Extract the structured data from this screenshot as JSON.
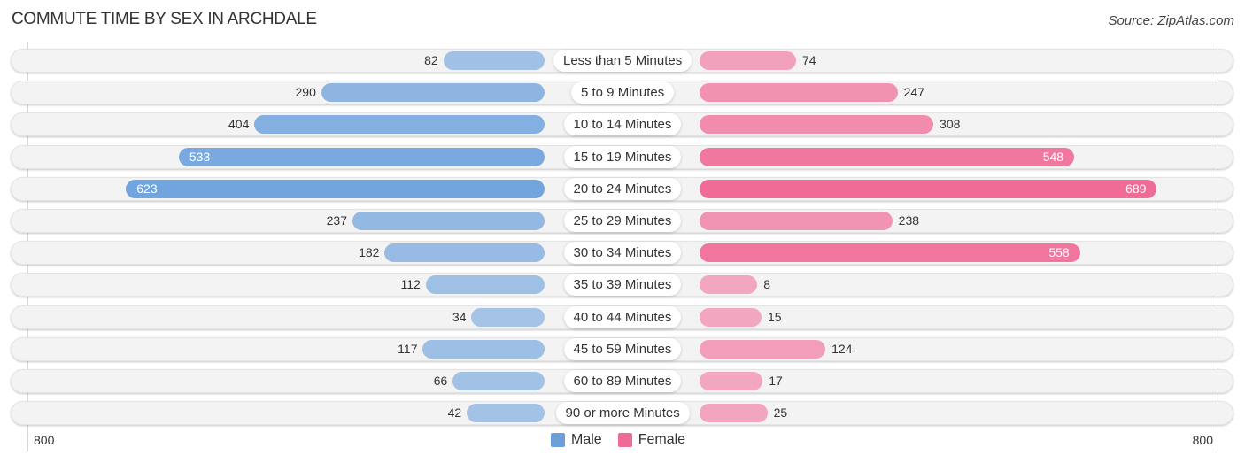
{
  "chart_data": {
    "type": "bar",
    "orientation": "horizontal-diverging",
    "title": "COMMUTE TIME BY SEX IN ARCHDALE",
    "source": "Source: ZipAtlas.com",
    "categories": [
      "Less than 5 Minutes",
      "5 to 9 Minutes",
      "10 to 14 Minutes",
      "15 to 19 Minutes",
      "20 to 24 Minutes",
      "25 to 29 Minutes",
      "30 to 34 Minutes",
      "35 to 39 Minutes",
      "40 to 44 Minutes",
      "45 to 59 Minutes",
      "60 to 89 Minutes",
      "90 or more Minutes"
    ],
    "series": [
      {
        "name": "Male",
        "color": "#6a9fdc",
        "values": [
          82,
          290,
          404,
          533,
          623,
          237,
          182,
          112,
          34,
          117,
          66,
          42
        ]
      },
      {
        "name": "Female",
        "color": "#f06a96",
        "values": [
          74,
          247,
          308,
          548,
          689,
          238,
          558,
          8,
          15,
          124,
          17,
          25
        ]
      }
    ],
    "axis": {
      "left_tick": "800",
      "right_tick": "800",
      "max": 800
    },
    "legend": {
      "position": "bottom-center",
      "items": [
        "Male",
        "Female"
      ]
    },
    "grid": false
  }
}
